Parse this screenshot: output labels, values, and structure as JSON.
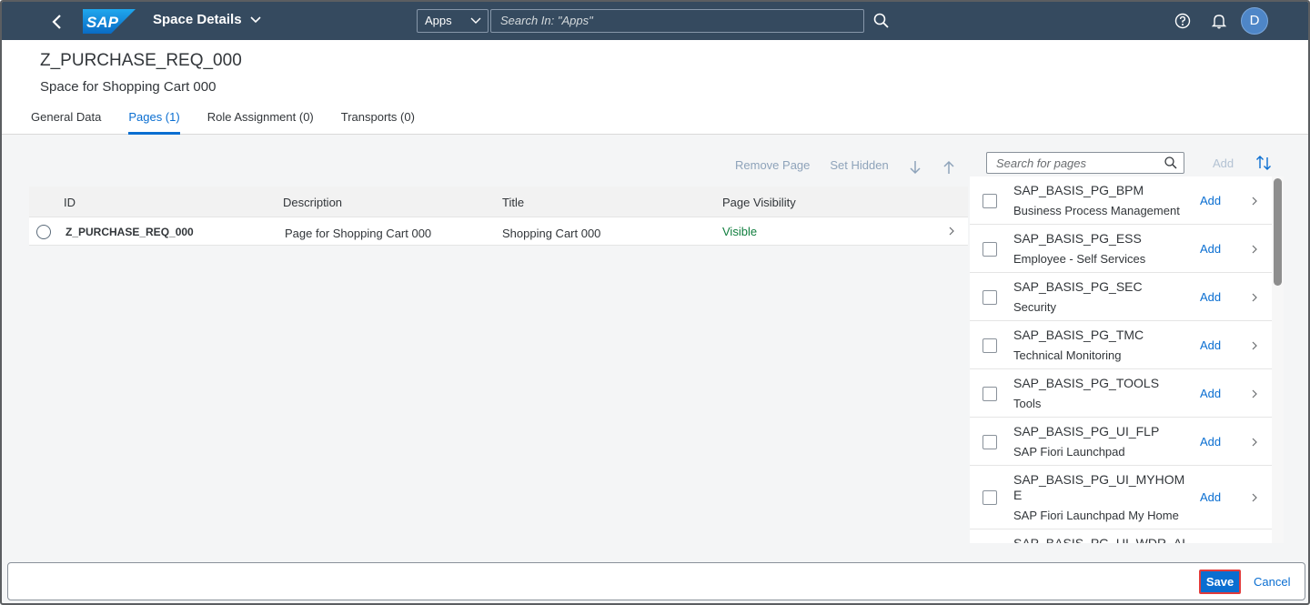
{
  "shell": {
    "title": "Space Details",
    "apps_select": "Apps",
    "search_placeholder": "Search In: \"Apps\"",
    "avatar_initial": "D"
  },
  "header": {
    "title": "Z_PURCHASE_REQ_000",
    "subtitle": "Space for Shopping Cart 000"
  },
  "tabs": [
    {
      "label": "General Data"
    },
    {
      "label": "Pages (1)"
    },
    {
      "label": "Role Assignment (0)"
    },
    {
      "label": "Transports (0)"
    }
  ],
  "toolbar": {
    "remove_page": "Remove Page",
    "set_hidden": "Set Hidden"
  },
  "table": {
    "columns": [
      "ID",
      "Description",
      "Title",
      "Page Visibility"
    ],
    "rows": [
      {
        "id": "Z_PURCHASE_REQ_000",
        "description": "Page for Shopping Cart 000",
        "title": "Shopping Cart 000",
        "visibility": "Visible"
      }
    ]
  },
  "right_panel": {
    "search_placeholder": "Search for pages",
    "add_label": "Add",
    "items": [
      {
        "name": "SAP_BASIS_PG_BPM",
        "desc": "Business Process Management",
        "add": "Add"
      },
      {
        "name": "SAP_BASIS_PG_ESS",
        "desc": "Employee - Self Services",
        "add": "Add"
      },
      {
        "name": "SAP_BASIS_PG_SEC",
        "desc": "Security",
        "add": "Add"
      },
      {
        "name": "SAP_BASIS_PG_TMC",
        "desc": "Technical Monitoring",
        "add": "Add"
      },
      {
        "name": "SAP_BASIS_PG_TOOLS",
        "desc": "Tools",
        "add": "Add"
      },
      {
        "name": "SAP_BASIS_PG_UI_FLP",
        "desc": "SAP Fiori Launchpad",
        "add": "Add"
      },
      {
        "name": "SAP_BASIS_PG_UI_MYHOME",
        "desc": "SAP Fiori Launchpad My Home",
        "add": "Add"
      },
      {
        "name": "SAP_BASIS_PG_UI_WDR_AI",
        "desc": "",
        "add": ""
      }
    ]
  },
  "footer": {
    "save": "Save",
    "cancel": "Cancel"
  },
  "colors": {
    "shell_bg": "#354a5f",
    "accent": "#0a6ed1",
    "visible_status": "#107e3e",
    "save_outline": "#e23b3b"
  }
}
